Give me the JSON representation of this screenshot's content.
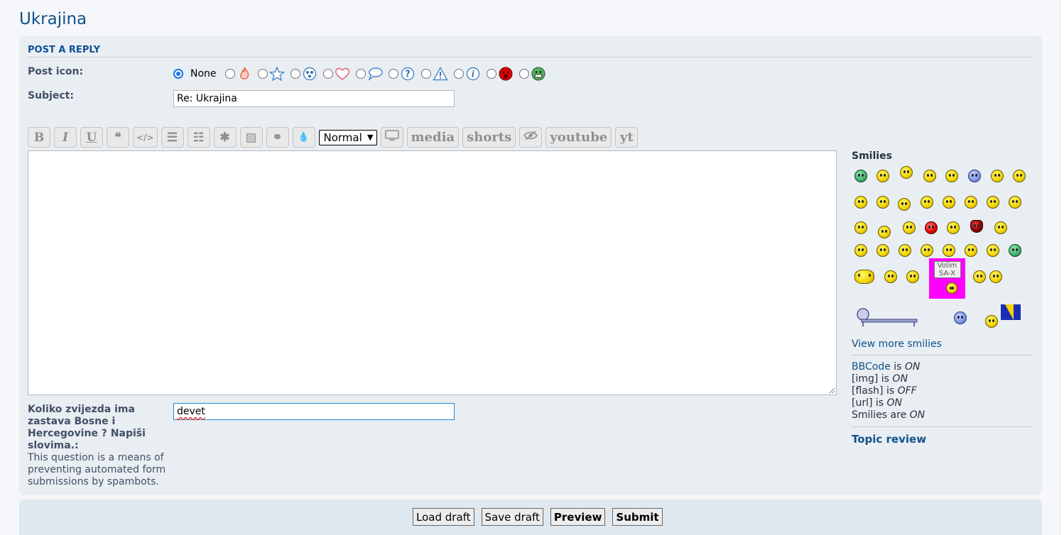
{
  "topic_title": "Ukrajina",
  "panel": {
    "title": "POST A REPLY",
    "post_icon_label": "Post icon:",
    "none_label": "None",
    "subject_label": "Subject:",
    "subject_value": "Re: Ukrajina",
    "post_icons": [
      "fire-icon",
      "star-icon",
      "radioactive-icon",
      "heart-icon",
      "speech-bubble-icon",
      "question-icon",
      "warning-icon",
      "info-icon",
      "mad-smiley-icon",
      "green-grin-icon"
    ]
  },
  "toolbar": {
    "bold": "B",
    "italic": "I",
    "underline": "U",
    "quote": "❝",
    "code": "</>",
    "list": "☰",
    "list_ordered": "☷",
    "list_item": "✱",
    "image": "▨",
    "link": "⚭",
    "color": "💧",
    "font_size_value": "Normal",
    "media_label": "media",
    "shorts_label": "shorts",
    "youtube_label": "youtube",
    "yt_label": "yt",
    "accent_color": "#8f8f8f"
  },
  "question": {
    "title": "Koliko zvijezda ima zastava Bosne i Hercegovine ? Napiši slovima.:",
    "explain": "This question is a means of preventing automated form submissions by spambots.",
    "answer": "devet"
  },
  "sidebar": {
    "smilies_heading": "Smilies",
    "sign_line1": "Volim",
    "sign_line2": "SA-X",
    "view_more": "View more smilies",
    "bbcode_link": "BBCode",
    "bbcode_is": " is ",
    "bbcode_state": "ON",
    "img_tag": "[img] is ",
    "img_state": "ON",
    "flash_tag": "[flash] is ",
    "flash_state": "OFF",
    "url_tag": "[url] is ",
    "url_state": "ON",
    "smilies_tag": "Smilies are ",
    "smilies_state": "ON",
    "topic_review": "Topic review"
  },
  "footer": {
    "load_draft": "Load draft",
    "save_draft": "Save draft",
    "preview": "Preview",
    "submit": "Submit"
  }
}
